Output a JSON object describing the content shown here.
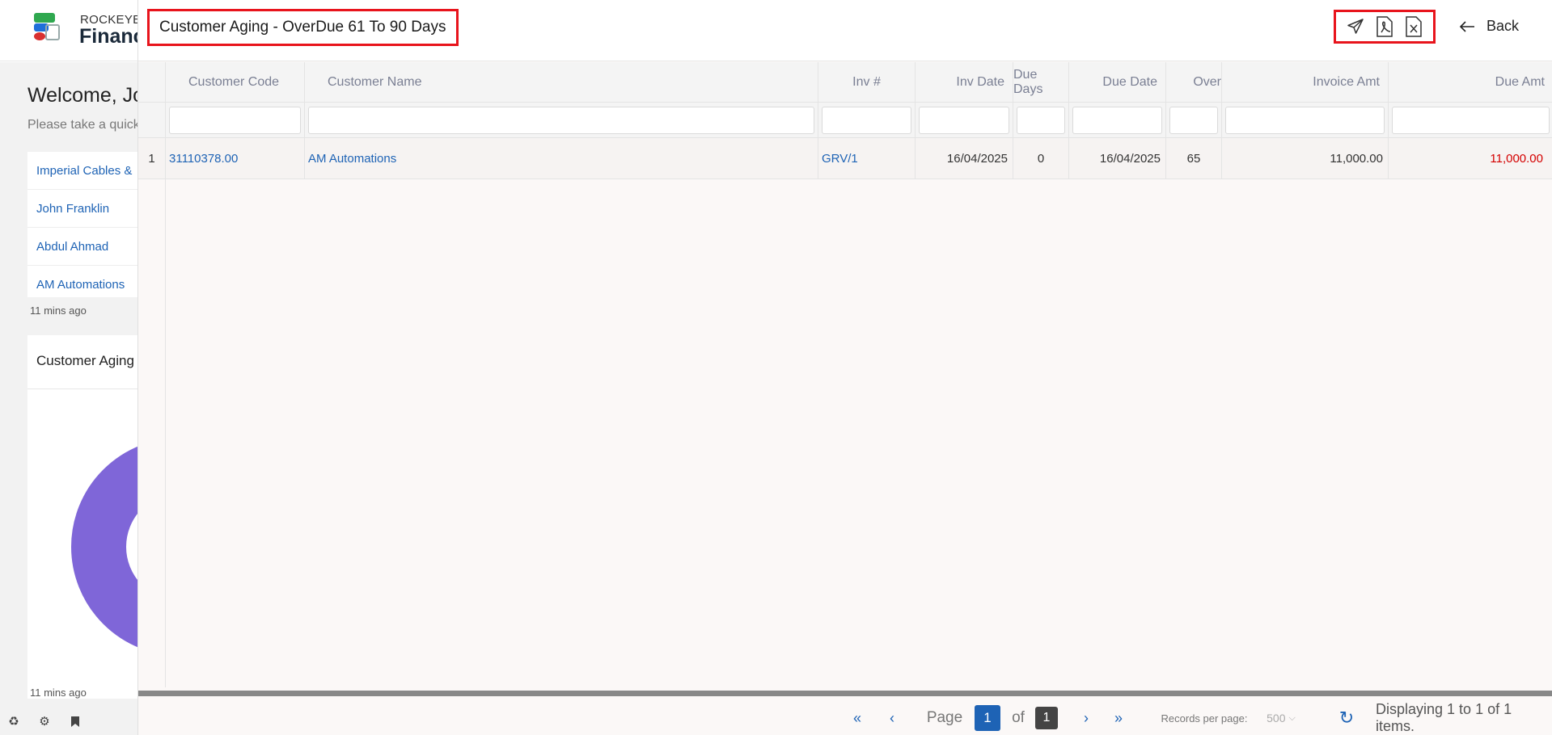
{
  "background": {
    "brand_top": "ROCKEYE",
    "brand_bottom": "Financ",
    "welcome": "Welcome, Jo",
    "welcome_sub": "Please take a quick",
    "list_items": [
      "Imperial Cables &",
      "John Franklin",
      "Abdul Ahmad",
      "AM Automations"
    ],
    "ago_1": "11 mins ago",
    "card_title": "Customer Aging",
    "ago_2": "11 mins ago",
    "chart_color": "#7f66d8"
  },
  "panel": {
    "title": "Customer Aging - OverDue 61 To 90 Days",
    "actions": {
      "send_icon": "send-icon",
      "pdf_icon": "pdf-icon",
      "excel_icon": "excel-icon"
    },
    "back_label": "Back"
  },
  "table": {
    "columns": [
      "Customer Code",
      "Customer Name",
      "Inv #",
      "Inv Date",
      "Due Days",
      "Due Date",
      "Over",
      "Invoice Amt",
      "Due Amt"
    ],
    "rows": [
      {
        "row_num": "1",
        "customer_code": "31110378.00",
        "customer_name": "AM Automations",
        "inv_no": "GRV/1",
        "inv_date": "16/04/2025",
        "due_days": "0",
        "due_date": "16/04/2025",
        "overdue": "65",
        "invoice_amt": "11,000.00",
        "due_amt": "11,000.00"
      }
    ]
  },
  "pager": {
    "page_label": "Page",
    "current_page": "1",
    "of_label": "of",
    "total_pages": "1",
    "records_label": "Records per page:",
    "records_value": "500",
    "displaying": "Displaying 1 to 1 of 1 items."
  },
  "colors": {
    "accent": "#1e63b5",
    "highlight_border": "#e8141c",
    "due_amount": "#d40000"
  }
}
